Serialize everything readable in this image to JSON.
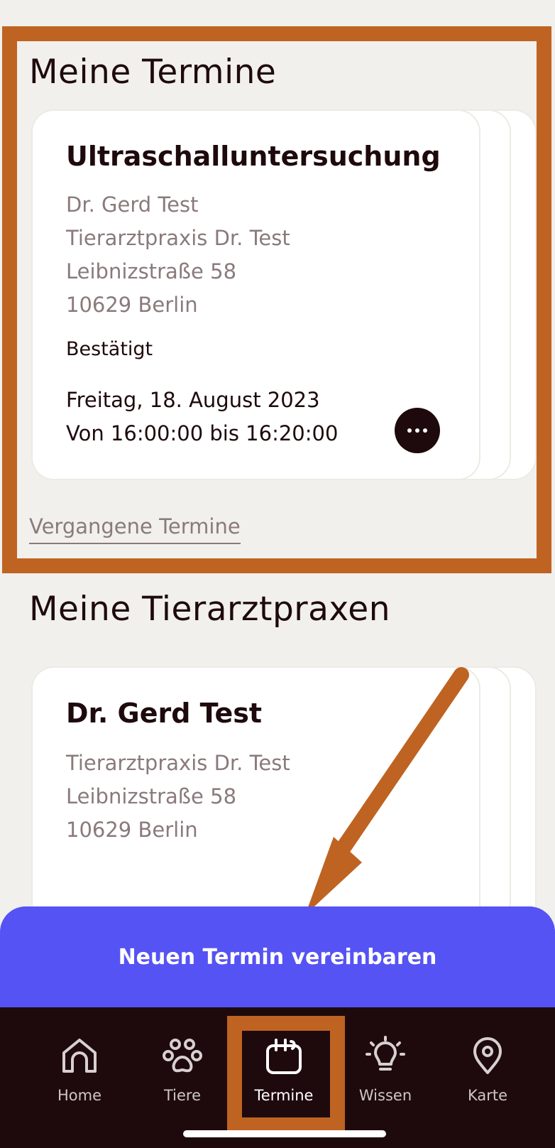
{
  "appointments": {
    "title": "Meine Termine",
    "card": {
      "title": "Ultraschalluntersuchung",
      "vet": "Dr. Gerd Test",
      "practice": "Tierarztpraxis Dr. Test",
      "street": "Leibnizstraße 58",
      "city": "10629 Berlin",
      "status": "Bestätigt",
      "date": "Freitag, 18. August 2023",
      "time": "Von 16:00:00 bis 16:20:00"
    },
    "past_link": "Vergangene Termine"
  },
  "practices": {
    "title": "Meine Tierarztpraxen",
    "card": {
      "title": "Dr. Gerd Test",
      "practice": "Tierarztpraxis Dr. Test",
      "street": "Leibnizstraße 58",
      "city": "10629 Berlin"
    }
  },
  "cta": {
    "label": "Neuen Termin vereinbaren"
  },
  "tabbar": {
    "items": [
      {
        "label": "Home",
        "icon": "home-icon"
      },
      {
        "label": "Tiere",
        "icon": "paw-icon"
      },
      {
        "label": "Termine",
        "icon": "calendar-icon",
        "active": true
      },
      {
        "label": "Wissen",
        "icon": "lightbulb-icon"
      },
      {
        "label": "Karte",
        "icon": "map-pin-icon"
      }
    ]
  },
  "colors": {
    "background": "#f1f0ec",
    "dark": "#1e0a0c",
    "cta": "#5553f3",
    "annotation": "#bf6322",
    "muted_text": "#8a7a7b"
  }
}
